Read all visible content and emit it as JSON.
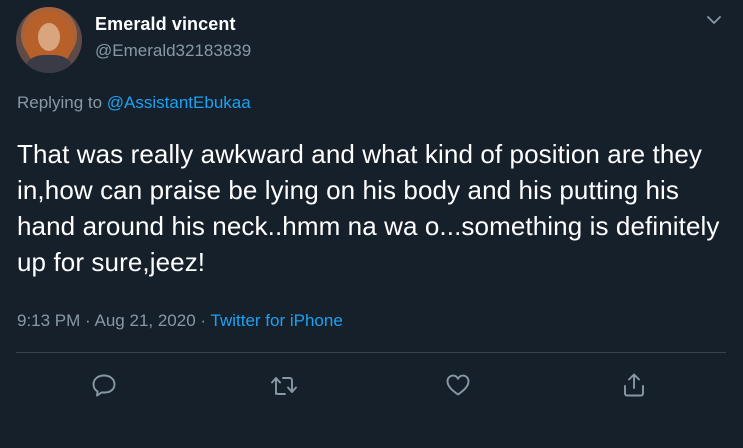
{
  "user": {
    "display_name": "Emerald vincent",
    "handle": "@Emerald32183839"
  },
  "reply": {
    "prefix": "Replying to",
    "mention": "@AssistantEbukaa"
  },
  "tweet": {
    "text": "That was really awkward and what kind of position are they in,how can praise be lying on his body and his putting his hand around his neck..hmm na wa o...something is definitely up for sure,jeez!",
    "time": "9:13 PM",
    "separator1": "·",
    "date": "Aug 21, 2020",
    "separator2": "·",
    "source": "Twitter for iPhone"
  },
  "actions": {
    "reply_icon": "comment-icon",
    "retweet_icon": "retweet-icon",
    "like_icon": "heart-icon",
    "share_icon": "share-icon"
  },
  "colors": {
    "background": "#15202b",
    "primary_text": "#ffffff",
    "secondary_text": "#8899a6",
    "accent": "#1da1f2",
    "divider": "#38444d"
  }
}
